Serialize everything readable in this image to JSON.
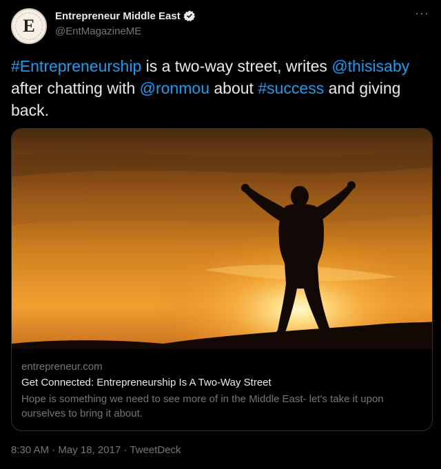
{
  "author": {
    "display_name": "Entrepreneur Middle East",
    "handle": "@EntMagazineME",
    "avatar_letter": "E",
    "verified": true
  },
  "tweet": {
    "segments": [
      {
        "text": "#Entrepreneurship",
        "link": true
      },
      {
        "text": " is a two-way street, writes ",
        "link": false
      },
      {
        "text": "@thisisaby",
        "link": true
      },
      {
        "text": " after chatting with ",
        "link": false
      },
      {
        "text": "@ronmou",
        "link": true
      },
      {
        "text": " about ",
        "link": false
      },
      {
        "text": "#success",
        "link": true
      },
      {
        "text": " and giving back.",
        "link": false
      }
    ]
  },
  "card": {
    "image_icon": "person-silhouette-sunset-image",
    "domain": "entrepreneur.com",
    "title": "Get Connected: Entrepreneurship Is A Two-Way Street",
    "description": "Hope is something we need to see more of in the Middle East- let's take it upon ourselves to bring it about."
  },
  "meta": {
    "time": "8:30 AM",
    "separator": " · ",
    "date": "May 18, 2017",
    "source": "TweetDeck"
  },
  "colors": {
    "background": "#000000",
    "text": "#e7e9ea",
    "muted": "#71767b",
    "link": "#1d9bf0",
    "border": "#2f3336"
  }
}
